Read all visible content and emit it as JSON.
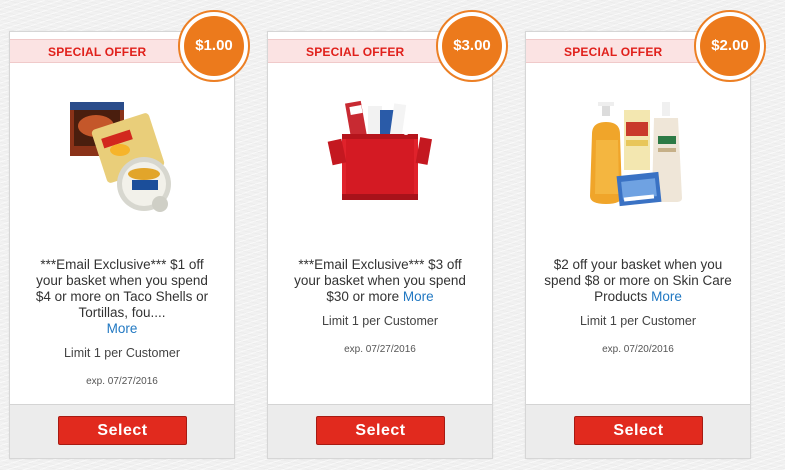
{
  "colors": {
    "banner_text": "#e0201b",
    "banner_bg": "#fbe3e3",
    "badge": "#ec7a1c",
    "button": "#e12a1e",
    "link": "#2178c2"
  },
  "coupons": [
    {
      "banner": "SPECIAL OFFER",
      "value": "$1.00",
      "product_icon": "taco-shells-tortillas-image",
      "description": "***Email Exclusive*** $1 off your basket when you spend $4 or more on Taco Shells or Tortillas, fou....",
      "more": "More",
      "limit": "Limit 1 per Customer",
      "expiry": "exp. 07/27/2016",
      "button": "Select"
    },
    {
      "banner": "SPECIAL OFFER",
      "value": "$3.00",
      "product_icon": "red-cooler-bag-image",
      "description": "***Email Exclusive*** $3 off your basket when you spend $30 or more",
      "more": "More",
      "limit": "Limit 1 per Customer",
      "expiry": "exp. 07/27/2016",
      "button": "Select"
    },
    {
      "banner": "SPECIAL OFFER",
      "value": "$2.00",
      "product_icon": "skin-care-products-image",
      "description": "$2 off your basket when you spend $8 or more on Skin Care Products",
      "more": "More",
      "limit": "Limit 1 per Customer",
      "expiry": "exp. 07/20/2016",
      "button": "Select"
    }
  ]
}
